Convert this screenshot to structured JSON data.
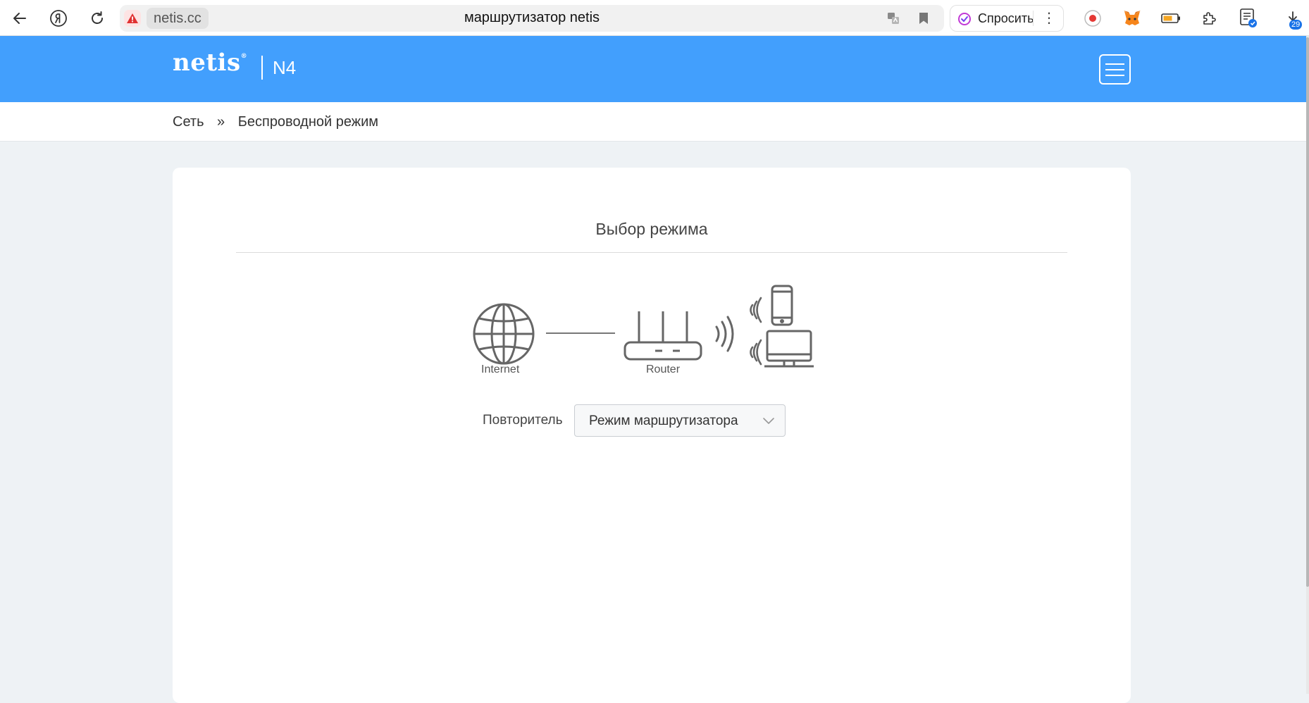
{
  "browser": {
    "domain": "netis.cc",
    "page_title": "маршрутизатор netis",
    "ask_label": "Спросить",
    "ask_more": "⋮",
    "downloads_count": "29"
  },
  "router": {
    "logo": "netis",
    "logo_mark": "®",
    "model": "N4"
  },
  "breadcrumb": {
    "section": "Сеть",
    "separator": "»",
    "page": "Беспроводной режим"
  },
  "card": {
    "title": "Выбор режима",
    "diagram": {
      "internet_label": "Internet",
      "router_label": "Router"
    },
    "mode_label": "Повторитель",
    "mode_value": "Режим маршрутизатора"
  },
  "colors": {
    "header_blue": "#429ffd",
    "page_bg": "#eef2f5",
    "warning_red": "#e03131"
  }
}
